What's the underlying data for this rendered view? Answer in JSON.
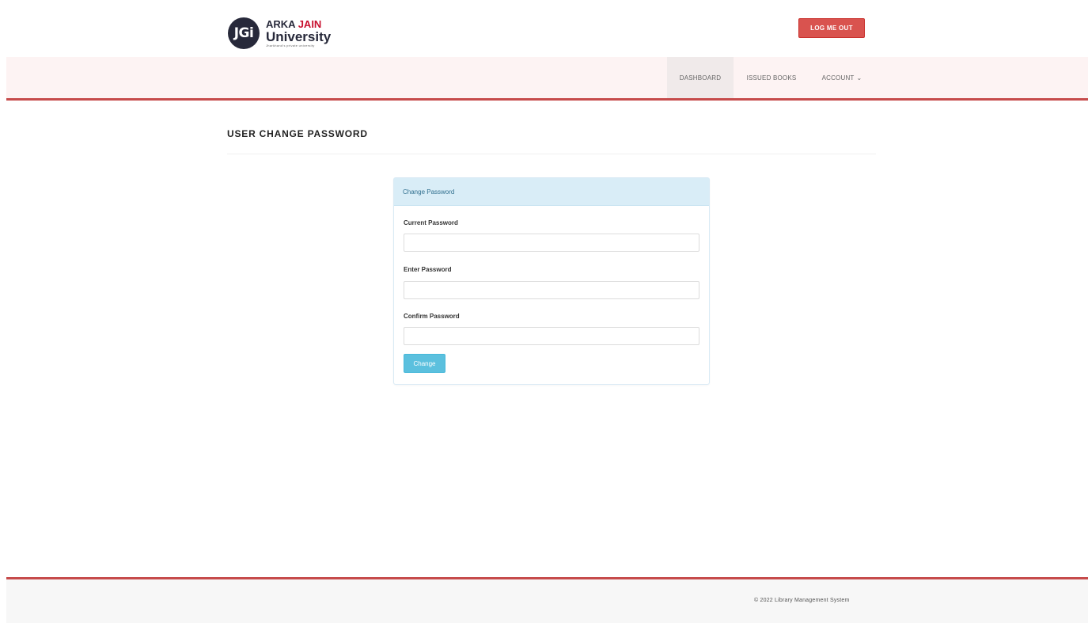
{
  "header": {
    "logo": {
      "mark": "JGi",
      "name_part1": "ARKA",
      "name_part2": "JAIN",
      "name_line2": "University",
      "tagline": "Jharkhand's private university"
    },
    "logout_label": "LOG ME OUT"
  },
  "nav": {
    "items": [
      {
        "label": "DASHBOARD"
      },
      {
        "label": "ISSUED BOOKS"
      },
      {
        "label": "ACCOUNT"
      }
    ],
    "account_caret": "⌄"
  },
  "page": {
    "title": "USER CHANGE PASSWORD"
  },
  "panel": {
    "heading": "Change Password",
    "fields": [
      {
        "label": "Current Password",
        "value": "",
        "placeholder": ""
      },
      {
        "label": "Enter Password",
        "value": "",
        "placeholder": ""
      },
      {
        "label": "Confirm Password",
        "value": "",
        "placeholder": ""
      }
    ],
    "submit_label": "Change"
  },
  "footer": {
    "text": "© 2022 Library Management System"
  },
  "colors": {
    "accent_red": "#c64b4b",
    "logout_button": "#d9534f",
    "info_button": "#5bc0de",
    "panel_heading_bg": "#d9edf7"
  }
}
